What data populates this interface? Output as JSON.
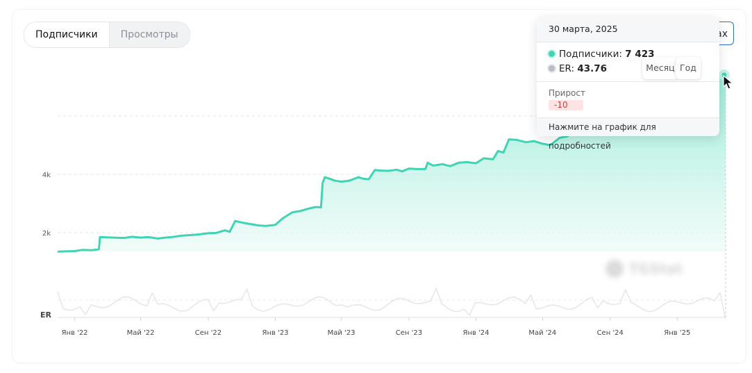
{
  "tabs": [
    {
      "label": "Подписчики",
      "active": true
    },
    {
      "label": "Просмотры",
      "active": false
    }
  ],
  "partially_hidden_button": {
    "label": "ах"
  },
  "tooltip": {
    "date": "30 марта, 2025",
    "subscribers_label": "Подписчики:",
    "subscribers_value": "7 423",
    "er_label": "ER:",
    "er_value": "43.76",
    "growth_label": "Прирост",
    "growth_value": "-10",
    "footer": "Нажмите на график для подробностей"
  },
  "period_buttons": {
    "month": "Месяц",
    "year": "Год"
  },
  "colors": {
    "line": "#3fd4b3",
    "area_top": "#8fe9d4",
    "er_line": "#e5e6e8",
    "growth_negative": "#d23b3b"
  },
  "chart_data": {
    "type": "area",
    "title": "",
    "series": [
      {
        "name": "Подписчики",
        "x": [
          "2021-12-01",
          "2021-12-15",
          "2022-01-01",
          "2022-01-15",
          "2022-02-01",
          "2022-02-14",
          "2022-02-16",
          "2022-03-01",
          "2022-03-15",
          "2022-04-01",
          "2022-04-15",
          "2022-05-01",
          "2022-05-15",
          "2022-06-01",
          "2022-06-15",
          "2022-07-01",
          "2022-07-15",
          "2022-08-01",
          "2022-08-15",
          "2022-09-01",
          "2022-09-15",
          "2022-10-01",
          "2022-10-10",
          "2022-10-20",
          "2022-11-01",
          "2022-11-15",
          "2022-12-01",
          "2022-12-15",
          "2023-01-01",
          "2023-01-15",
          "2023-02-01",
          "2023-02-15",
          "2023-03-01",
          "2023-03-15",
          "2023-03-25",
          "2023-03-28",
          "2023-04-01",
          "2023-04-10",
          "2023-04-20",
          "2023-05-01",
          "2023-05-15",
          "2023-06-01",
          "2023-06-10",
          "2023-06-20",
          "2023-07-01",
          "2023-07-10",
          "2023-07-25",
          "2023-08-10",
          "2023-08-20",
          "2023-09-01",
          "2023-09-15",
          "2023-10-01",
          "2023-10-05",
          "2023-10-15",
          "2023-11-01",
          "2023-11-15",
          "2023-12-01",
          "2023-12-15",
          "2024-01-01",
          "2024-01-15",
          "2024-02-01",
          "2024-02-10",
          "2024-02-20",
          "2024-03-01",
          "2024-03-15",
          "2024-04-01",
          "2024-04-15",
          "2024-05-01",
          "2024-05-15",
          "2024-06-01",
          "2024-06-15",
          "2024-07-01",
          "2024-07-15",
          "2024-08-01",
          "2024-08-15",
          "2024-09-01",
          "2024-09-15",
          "2024-10-01",
          "2024-10-15",
          "2024-11-01",
          "2024-11-15",
          "2024-12-01",
          "2024-12-15",
          "2025-01-01",
          "2025-01-15",
          "2025-02-01",
          "2025-02-15",
          "2025-03-01",
          "2025-03-15",
          "2025-03-30"
        ],
        "values": [
          1350,
          1360,
          1370,
          1410,
          1400,
          1430,
          1850,
          1840,
          1830,
          1820,
          1860,
          1830,
          1850,
          1800,
          1830,
          1860,
          1900,
          1920,
          1940,
          1980,
          1990,
          2080,
          2030,
          2400,
          2350,
          2300,
          2250,
          2230,
          2270,
          2500,
          2700,
          2740,
          2820,
          2880,
          2870,
          3700,
          3900,
          3850,
          3780,
          3750,
          3780,
          3900,
          3850,
          3830,
          4150,
          4130,
          4120,
          4160,
          4100,
          4200,
          4180,
          4180,
          4400,
          4300,
          4350,
          4280,
          4400,
          4420,
          4380,
          4550,
          4520,
          4800,
          4750,
          5200,
          5180,
          5100,
          5140,
          5050,
          5000,
          5250,
          5300,
          5500,
          5550,
          5600,
          5750,
          5900,
          6000,
          6150,
          6300,
          6500,
          6650,
          6800,
          6950,
          7050,
          7150,
          7250,
          7320,
          7380,
          7433,
          7423
        ]
      },
      {
        "name": "ER",
        "shape": "low fluctuating line at bottom band"
      }
    ],
    "ylabel": "",
    "xlabel": "",
    "y_ticks": [
      "2k",
      "4k"
    ],
    "ylim": [
      0,
      8000
    ],
    "x_ticks": [
      "Янв '22",
      "Май '22",
      "Сен '22",
      "Янв '23",
      "Май '23",
      "Сен '23",
      "Янв '24",
      "Май '24",
      "Сен '24",
      "Янв '25"
    ],
    "er_axis_label": "ER",
    "grid": true,
    "hover_point": {
      "date": "2025-03-30",
      "value": 7423
    }
  }
}
